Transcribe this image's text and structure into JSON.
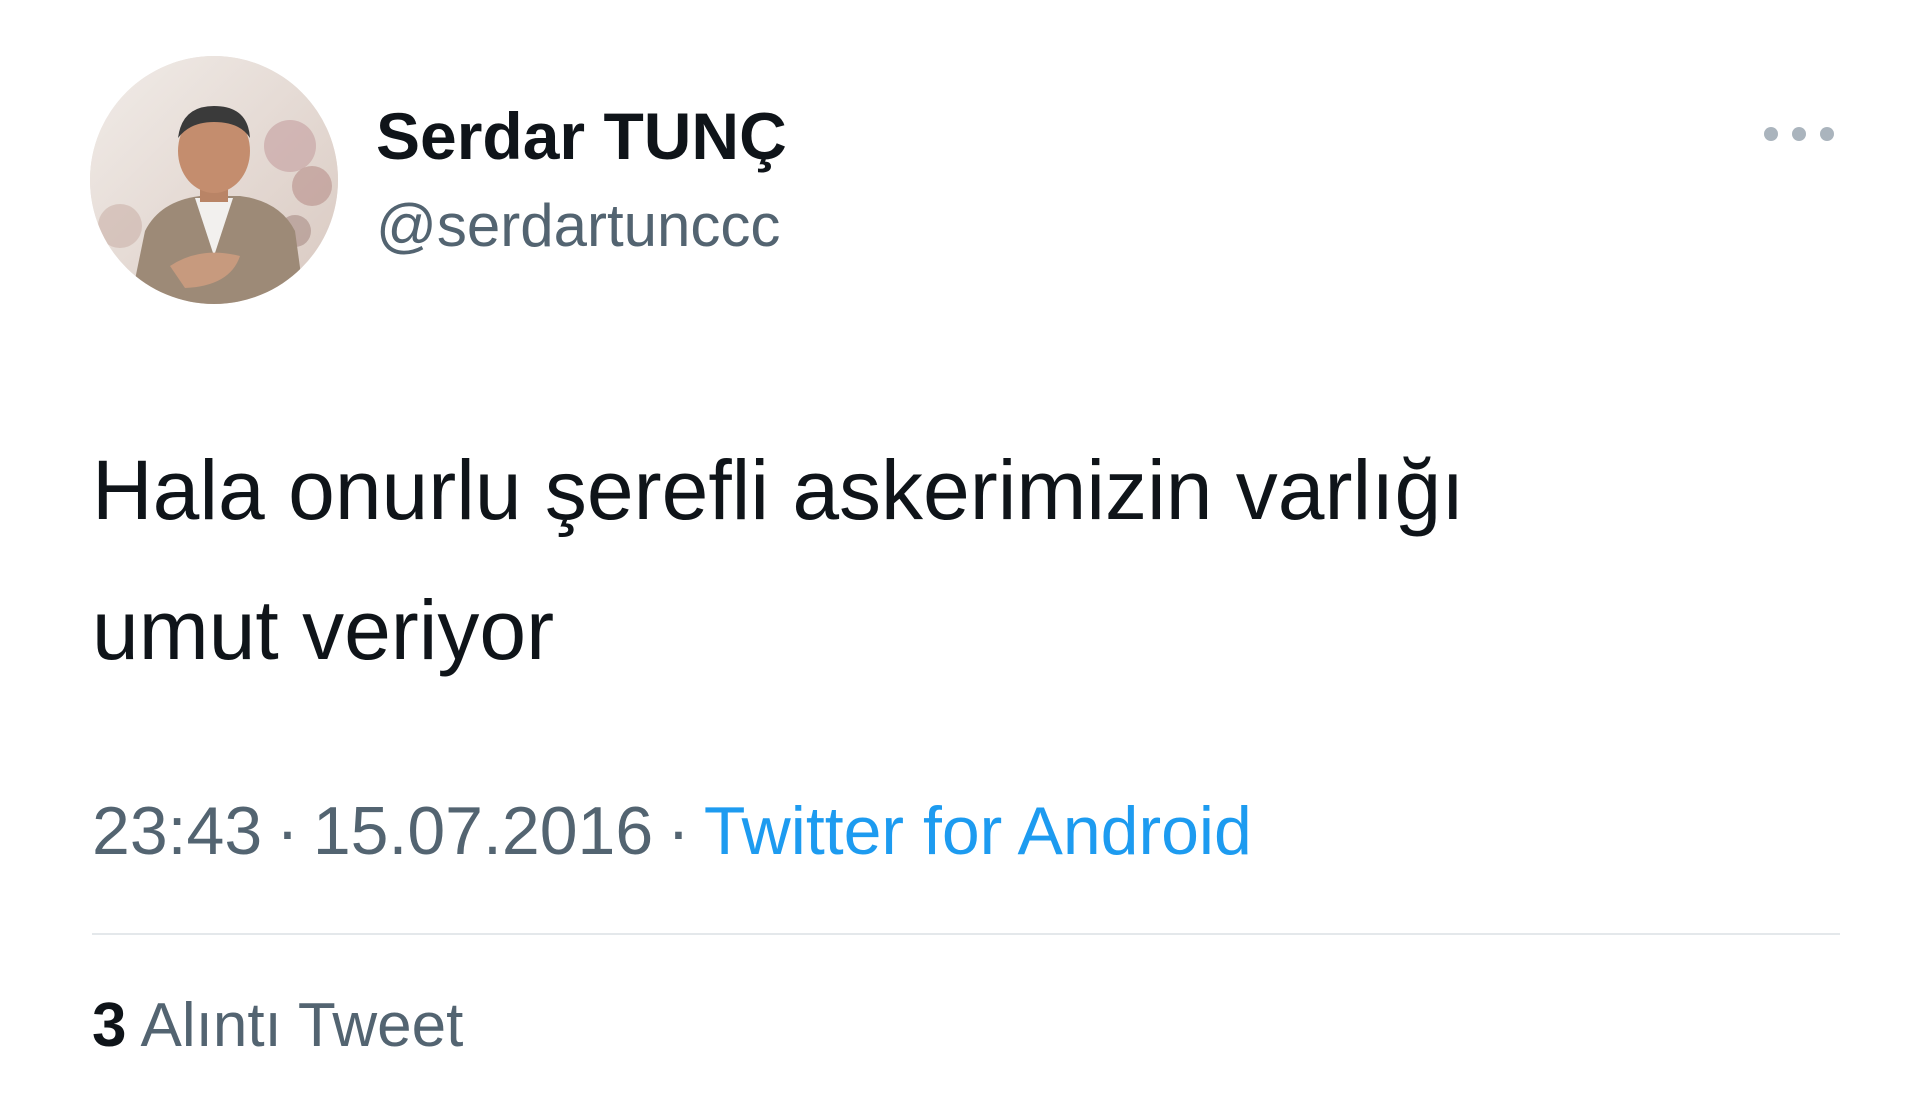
{
  "tweet": {
    "author": {
      "display_name": "Serdar TUNÇ",
      "handle": "@serdartunccc"
    },
    "text_lines": [
      "Hala onurlu şerefli askerimizin varlığı",
      "umut veriyor"
    ],
    "time": "23:43",
    "date": "15.07.2016",
    "separator": "·",
    "source": "Twitter for Android",
    "quote_count": "3",
    "quote_label": "Alıntı Tweet"
  },
  "icons": {
    "more": "more-horizontal-icon",
    "avatar": "profile-photo"
  },
  "colors": {
    "text_primary": "#0f1419",
    "text_secondary": "#536471",
    "link": "#1d9bf0",
    "divider": "#e4e8eb"
  }
}
